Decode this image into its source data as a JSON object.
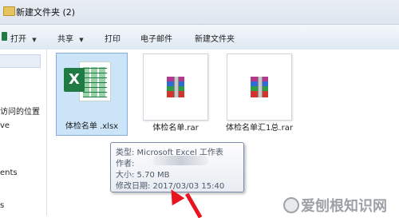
{
  "window": {
    "title": "新建文件夹 (2)"
  },
  "toolbar": {
    "open": "打开",
    "share": "共享",
    "print": "打印",
    "email": "电子邮件",
    "new_folder": "新建文件夹"
  },
  "nav": {
    "items": [
      {
        "label": "访问的位置"
      },
      {
        "label": "ve"
      },
      {
        "label": "ents"
      },
      {
        "label": "s"
      }
    ]
  },
  "files": [
    {
      "label": "体检名单 .xlsx",
      "icon": "excel-file-icon"
    },
    {
      "label": "体检名单.rar",
      "icon": "rar-archive-icon"
    },
    {
      "label": "体检名单汇1总.rar",
      "icon": "rar-archive-icon"
    }
  ],
  "tooltip": {
    "type": "类型: Microsoft Excel 工作表",
    "author": "作者:",
    "size": "大小: 5.70 MB",
    "modified": "修改日期: 2017/03/03 15:40"
  },
  "watermark": {
    "text": "爱刨根知识网"
  },
  "colors": {
    "excel_green": "#1f7a44",
    "selection": "#cce4f8",
    "annotation_arrow": "#e8141e"
  }
}
